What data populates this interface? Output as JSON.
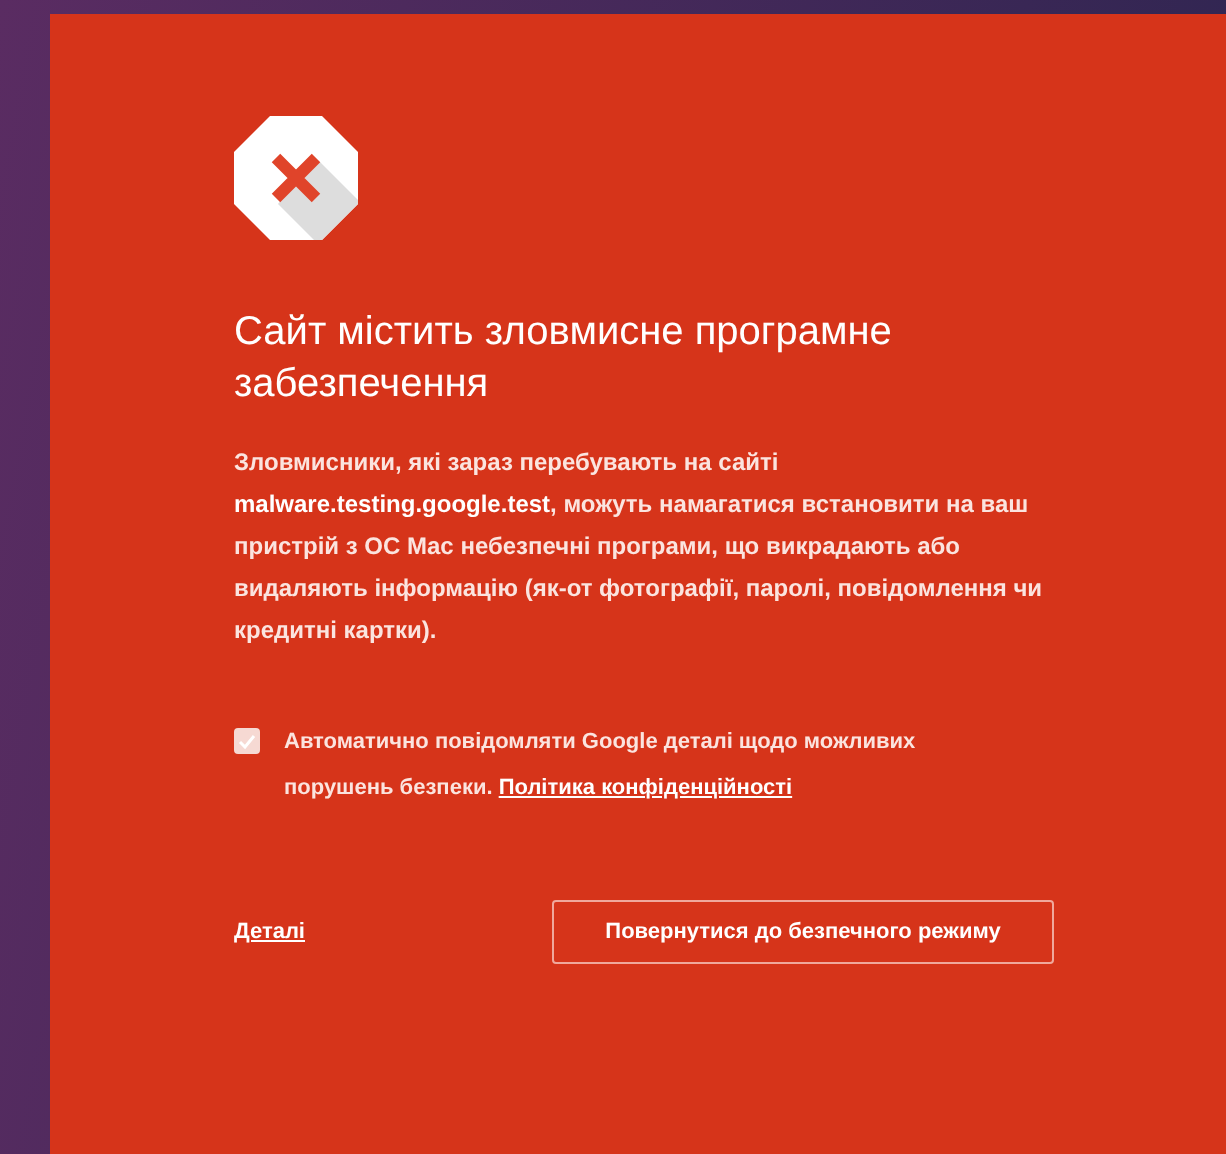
{
  "heading": "Сайт містить зловмисне програмне забезпечення",
  "message": "Зловмисники, які зараз перебувають на сайті **malware.testing.google.test**, можуть намагатися встановити на ваш пристрій з ОС Mac небезпечні програми, що викрадають або видаляють інформацію (як-от фотографії, паролі, повідомлення чи кредитні картки).",
  "report_option": {
    "checked": true,
    "label": "Автоматично повідомляти Google деталі щодо можливих порушень безпеки.",
    "link": "Політика конфіденційності"
  },
  "details_link": "Деталі",
  "primary_button": "Повернутися до безпечного режиму"
}
